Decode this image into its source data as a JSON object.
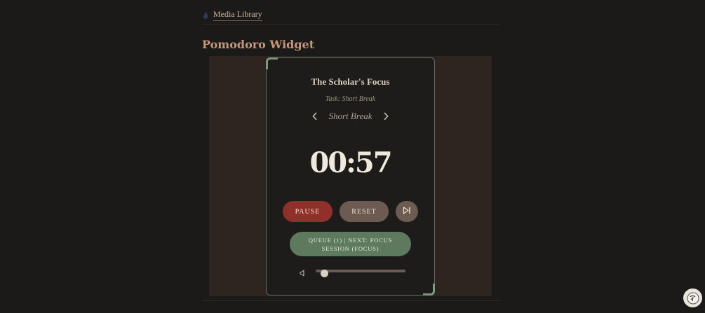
{
  "breadcrumb": {
    "label": "Media Library"
  },
  "section": {
    "title": "Pomodoro Widget"
  },
  "widget": {
    "title": "The Scholar's Focus",
    "task": "Task: Short Break",
    "mode": "Short Break",
    "time": "00:57",
    "pause_label": "PAUSE",
    "reset_label": "RESET",
    "queue_label": "QUEUE (1) | NEXT: FOCUS SESSION (FOCUS)",
    "volume": 0.09
  },
  "colors": {
    "background": "#1b1a19",
    "embed_background": "#2e2420",
    "title_accent": "#c5967a",
    "pause": "#8f302a",
    "reset": "#6d5a50",
    "queue": "#5d7a5e",
    "card_border": "#5f6f5c"
  },
  "icons": {
    "breadcrumb": "flame-icon",
    "prev": "chevron-left-icon",
    "next": "chevron-right-icon",
    "skip": "skip-forward-icon",
    "volume": "speaker-icon",
    "assistant": "assistant-avatar-icon"
  }
}
